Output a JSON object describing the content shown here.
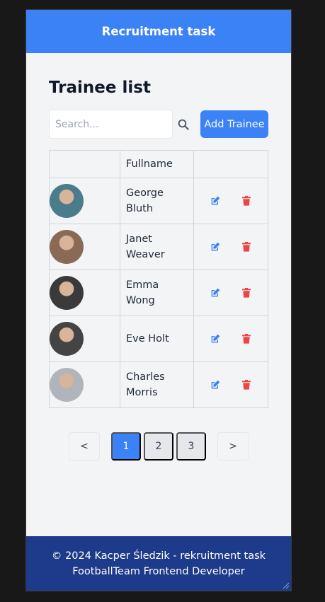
{
  "header": {
    "title": "Recruitment task"
  },
  "main": {
    "title": "Trainee list",
    "search": {
      "placeholder": "Search...",
      "icon": "search-icon"
    },
    "add_button": "Add Trainee"
  },
  "table": {
    "columns": [
      "",
      "Fullname",
      ""
    ],
    "rows": [
      {
        "name": "George Bluth",
        "avatar_color": "#4a7c8c"
      },
      {
        "name": "Janet Weaver",
        "avatar_color": "#8a6a54"
      },
      {
        "name": "Emma Wong",
        "avatar_color": "#3a3a3a"
      },
      {
        "name": "Eve Holt",
        "avatar_color": "#444444"
      },
      {
        "name": "Charles Morris",
        "avatar_color": "#b0b4bb"
      }
    ],
    "edit_icon": "edit-icon",
    "delete_icon": "trash-icon"
  },
  "pagination": {
    "prev": "<",
    "pages": [
      "1",
      "2",
      "3"
    ],
    "current": "1",
    "next": ">"
  },
  "footer": {
    "line1": "© 2024 Kacper Śledzik - rekruitment task",
    "line2": "FootballTeam Frontend Developer"
  },
  "colors": {
    "accent": "#3b82f6",
    "footer_bg": "#1e3a8a",
    "edit": "#3b82f6",
    "delete": "#ef4444"
  }
}
